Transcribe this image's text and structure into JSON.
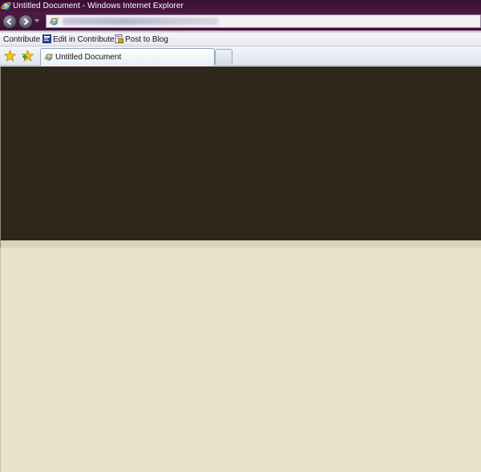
{
  "window": {
    "title": "Untitled Document - Windows Internet Explorer",
    "app_icon": "internet-explorer-icon"
  },
  "navigation": {
    "back_icon": "back-arrow-icon",
    "forward_icon": "forward-arrow-icon",
    "history_dropdown_icon": "chevron-down-icon",
    "address": {
      "page_icon": "internet-explorer-icon",
      "url_blurred": true
    }
  },
  "toolbar": {
    "contribute_label": "Contribute",
    "edit_label": "Edit in Contribute",
    "edit_icon": "contribute-edit-icon",
    "blog_label": "Post to Blog",
    "blog_icon": "blog-post-icon"
  },
  "tabs": {
    "favorites_icon": "favorites-star-icon",
    "add_favorite_icon": "add-favorite-icon",
    "items": [
      {
        "label": "Untitled Document",
        "icon": "internet-explorer-icon",
        "active": true
      }
    ],
    "new_tab_icon": "new-tab-icon"
  },
  "colors": {
    "titlebar": "#3a0f33",
    "hero_background": "#2f271b",
    "page_background": "#e9e3cc",
    "hero_bottom_band": "#d9d3bb"
  }
}
